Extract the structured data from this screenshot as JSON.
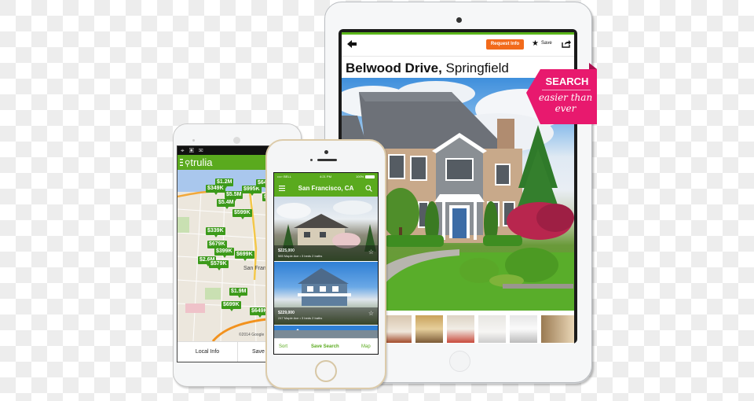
{
  "colors": {
    "trulia_green": "#5aaa1e",
    "pin_green": "#3c9a1a",
    "request_orange": "#f26a1b",
    "badge_pink": "#e8196e"
  },
  "tablet": {
    "toolbar": {
      "back_icon": "arrow-left-icon",
      "request_label": "Request Info",
      "save_icon": "star-icon",
      "save_label": "Save",
      "share_icon": "share-icon"
    },
    "listing": {
      "street": "Belwood Drive,",
      "city": "Springfield"
    },
    "photo_thumbnails": [
      "yard",
      "bedroom",
      "living room",
      "sitting room",
      "laundry room",
      "kitchen",
      "bedroom 2"
    ]
  },
  "promo_badge": {
    "title": "SEARCH",
    "subtitle_line1": "easier than",
    "subtitle_line2": "ever"
  },
  "android": {
    "status_icons": "⌖ ▣ ✉",
    "app_logo": "trulia",
    "map_label": "San Francisco",
    "map_copyright": "©2014 Google",
    "price_pins": [
      "$1.2M",
      "$349K",
      "$995K",
      "$649K",
      "$5.5M",
      "$1.7M",
      "$5.4M",
      "$599K",
      "$339K",
      "$679K",
      "$399K",
      "$699K",
      "$2.6M",
      "$579K",
      "$1.9M",
      "$699K",
      "$649K"
    ],
    "tabs": [
      {
        "label": "Local Info"
      },
      {
        "label": "Save Search"
      }
    ]
  },
  "iphone": {
    "status": {
      "carrier": "••••◦ BELL",
      "time": "4:21 PM",
      "battery": "100%"
    },
    "nav_title": "San Francisco, CA",
    "listings": [
      {
        "price": "$225,000",
        "details": "585 Maple Ave • 3 beds  2 baths"
      },
      {
        "price": "$229,000",
        "details": "247 Maple Ave • 3 beds  2 baths"
      }
    ],
    "tabs": [
      {
        "label": "Sort"
      },
      {
        "label": "Save Search"
      },
      {
        "label": "Map"
      }
    ]
  }
}
